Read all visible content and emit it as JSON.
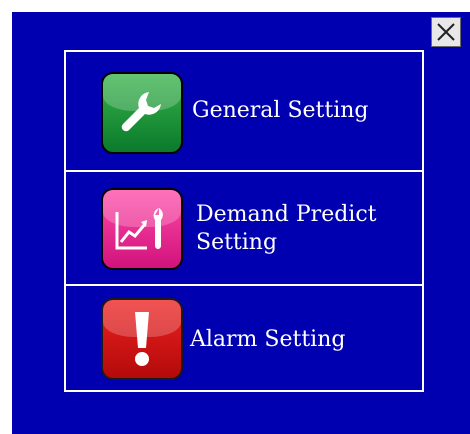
{
  "menu": {
    "items": [
      {
        "label": "General Setting",
        "icon": "wrench-icon",
        "color": "#1a9a3a"
      },
      {
        "label_line1": "Demand Predict",
        "label_line2": "Setting",
        "icon": "chart-wrench-icon",
        "color": "#e21b8a"
      },
      {
        "label": "Alarm Setting",
        "icon": "exclamation-icon",
        "color": "#d01414"
      }
    ]
  },
  "close": {
    "icon": "close-icon"
  },
  "colors": {
    "panel_bg": "#0000b0",
    "text": "#ffffff"
  }
}
